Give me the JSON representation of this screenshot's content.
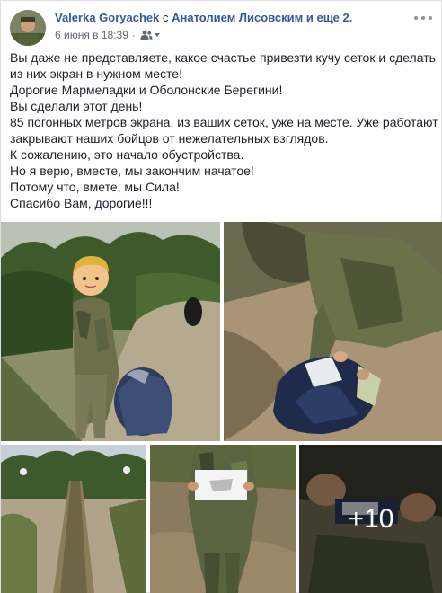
{
  "post": {
    "author": "Valerka Goryachek",
    "with_word": "с",
    "tagged_person": "Анатолием Лисовским",
    "and_others": "и еще 2.",
    "timestamp": "6 июня в 18:39",
    "dot": "·",
    "audience_icon": "friends-icon",
    "body_lines": [
      "Вы даже не представляете, какое счастье привезти кучу сеток и сделать",
      "из них экран в нужном месте!",
      "Дорогие Мармеладки и Оболонские Берегини!",
      "Вы сделали этот день!",
      "85 погонных метров экрана, из ваших сеток, уже на месте. Уже работают и",
      "закрывают наших бойцов от нежелательных взглядов.",
      "К сожалению, это начало обустройства.",
      "Но я верю, вместе, мы закончим начатое!",
      "Потому что, вмете, мы Сила!",
      "Спасибо Вам, дорогие!!!"
    ]
  },
  "photos": {
    "more_count": "+10"
  },
  "colors": {
    "link": "#385898",
    "text": "#1d2129",
    "meta": "#616770"
  }
}
